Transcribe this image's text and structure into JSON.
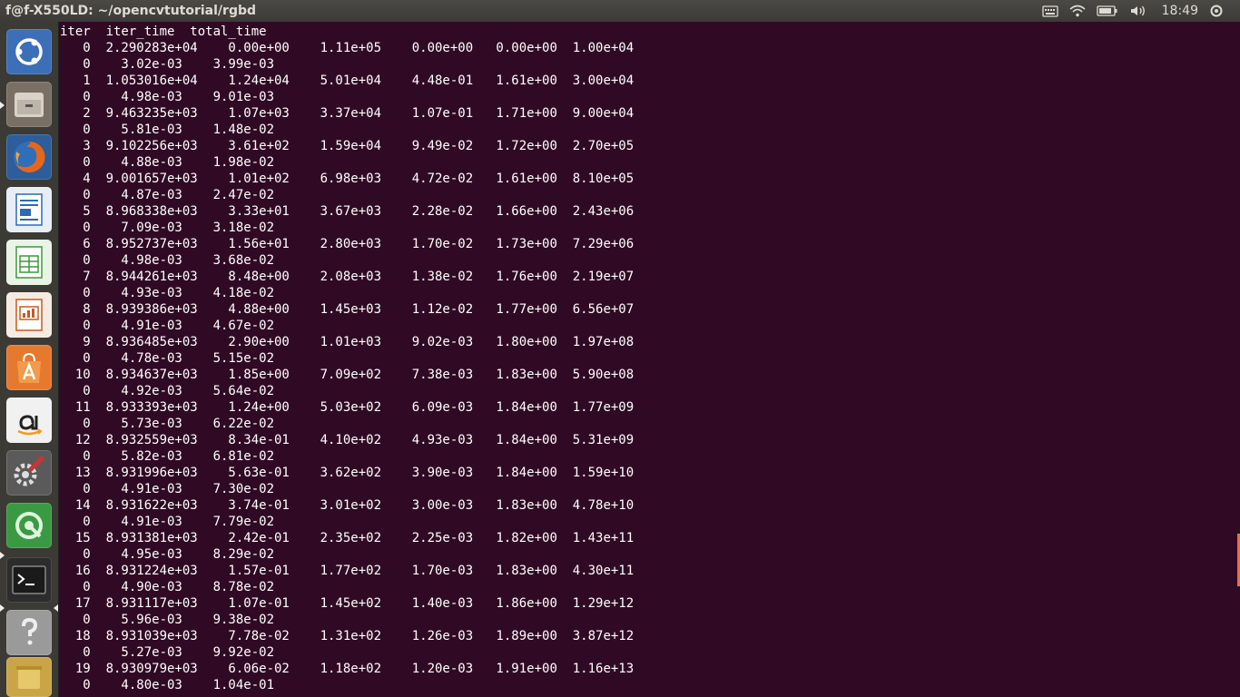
{
  "window": {
    "title": "f@f-X550LD: ~/opencvtutorial/rgbd"
  },
  "indicators": {
    "clock": "18:49"
  },
  "launcher": {
    "items": [
      {
        "name": "dash-home-icon"
      },
      {
        "name": "files-icon"
      },
      {
        "name": "firefox-icon"
      },
      {
        "name": "writer-icon"
      },
      {
        "name": "calc-icon"
      },
      {
        "name": "impress-icon"
      },
      {
        "name": "software-center-icon"
      },
      {
        "name": "amazon-icon"
      },
      {
        "name": "system-settings-icon"
      },
      {
        "name": "green-app-icon"
      },
      {
        "name": "terminal-icon"
      },
      {
        "name": "help-icon"
      }
    ]
  },
  "terminal": {
    "header": "iter  iter_time  total_time",
    "lines": [
      "   0  2.290283e+04    0.00e+00    1.11e+05    0.00e+00   0.00e+00  1.00e+04",
      "   0    3.02e-03    3.99e-03",
      "   1  1.053016e+04    1.24e+04    5.01e+04    4.48e-01   1.61e+00  3.00e+04",
      "   0    4.98e-03    9.01e-03",
      "   2  9.463235e+03    1.07e+03    3.37e+04    1.07e-01   1.71e+00  9.00e+04",
      "   0    5.81e-03    1.48e-02",
      "   3  9.102256e+03    3.61e+02    1.59e+04    9.49e-02   1.72e+00  2.70e+05",
      "   0    4.88e-03    1.98e-02",
      "   4  9.001657e+03    1.01e+02    6.98e+03    4.72e-02   1.61e+00  8.10e+05",
      "   0    4.87e-03    2.47e-02",
      "   5  8.968338e+03    3.33e+01    3.67e+03    2.28e-02   1.66e+00  2.43e+06",
      "   0    7.09e-03    3.18e-02",
      "   6  8.952737e+03    1.56e+01    2.80e+03    1.70e-02   1.73e+00  7.29e+06",
      "   0    4.98e-03    3.68e-02",
      "   7  8.944261e+03    8.48e+00    2.08e+03    1.38e-02   1.76e+00  2.19e+07",
      "   0    4.93e-03    4.18e-02",
      "   8  8.939386e+03    4.88e+00    1.45e+03    1.12e-02   1.77e+00  6.56e+07",
      "   0    4.91e-03    4.67e-02",
      "   9  8.936485e+03    2.90e+00    1.01e+03    9.02e-03   1.80e+00  1.97e+08",
      "   0    4.78e-03    5.15e-02",
      "  10  8.934637e+03    1.85e+00    7.09e+02    7.38e-03   1.83e+00  5.90e+08",
      "   0    4.92e-03    5.64e-02",
      "  11  8.933393e+03    1.24e+00    5.03e+02    6.09e-03   1.84e+00  1.77e+09",
      "   0    5.73e-03    6.22e-02",
      "  12  8.932559e+03    8.34e-01    4.10e+02    4.93e-03   1.84e+00  5.31e+09",
      "   0    5.82e-03    6.81e-02",
      "  13  8.931996e+03    5.63e-01    3.62e+02    3.90e-03   1.84e+00  1.59e+10",
      "   0    4.91e-03    7.30e-02",
      "  14  8.931622e+03    3.74e-01    3.01e+02    3.00e-03   1.83e+00  4.78e+10",
      "   0    4.91e-03    7.79e-02",
      "  15  8.931381e+03    2.42e-01    2.35e+02    2.25e-03   1.82e+00  1.43e+11",
      "   0    4.95e-03    8.29e-02",
      "  16  8.931224e+03    1.57e-01    1.77e+02    1.70e-03   1.83e+00  4.30e+11",
      "   0    4.90e-03    8.78e-02",
      "  17  8.931117e+03    1.07e-01    1.45e+02    1.40e-03   1.86e+00  1.29e+12",
      "   0    5.96e-03    9.38e-02",
      "  18  8.931039e+03    7.78e-02    1.31e+02    1.26e-03   1.89e+00  3.87e+12",
      "   0    5.27e-03    9.92e-02",
      "  19  8.930979e+03    6.06e-02    1.18e+02    1.20e-03   1.91e+00  1.16e+13",
      "   0    4.80e-03    1.04e-01"
    ]
  }
}
